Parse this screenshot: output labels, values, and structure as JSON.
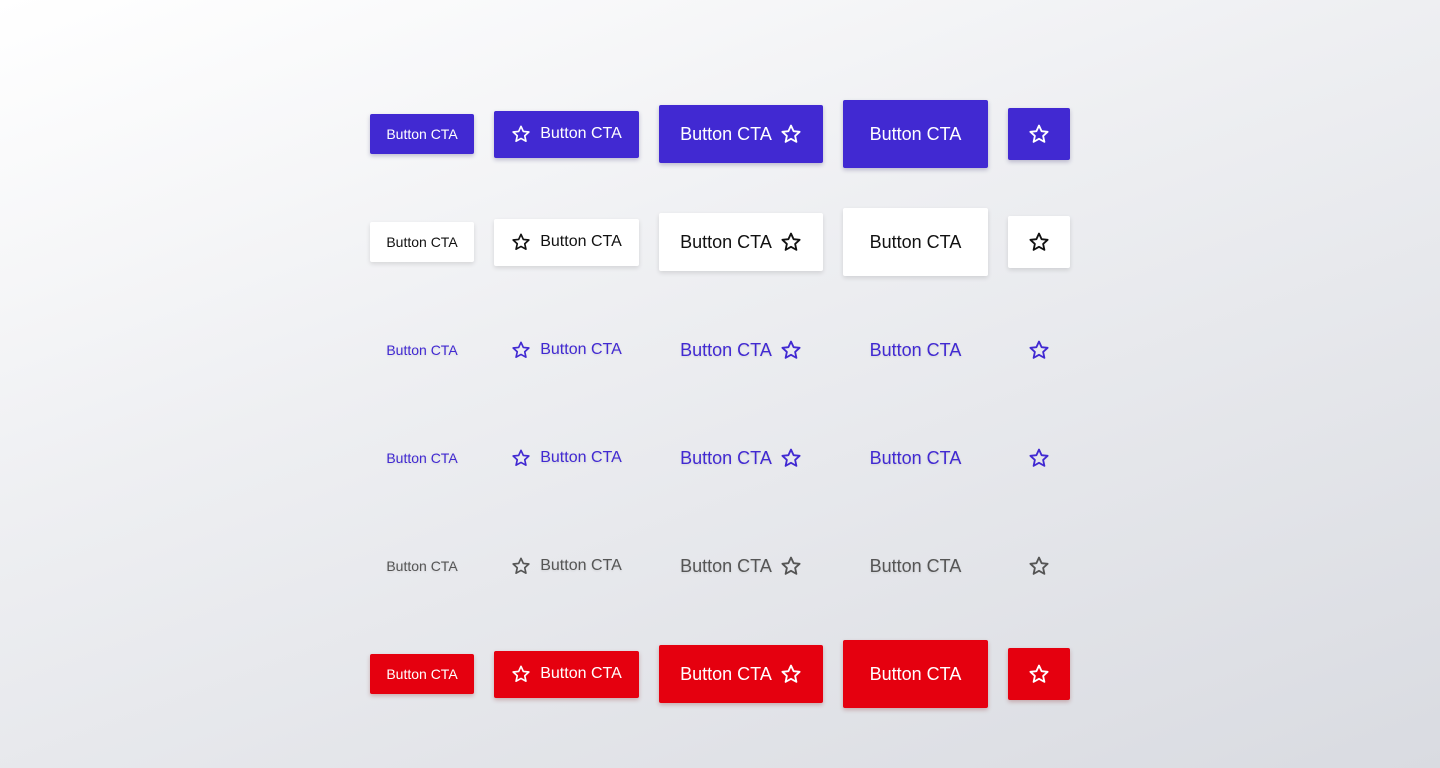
{
  "button_label": "Button CTA",
  "icon": "star-outline-icon",
  "colors": {
    "primary": "#4129d2",
    "danger": "#e5000f",
    "neutral_text": "#555555",
    "secondary_bg": "#ffffff"
  },
  "rows": [
    {
      "variant": "primary",
      "labels": [
        "Button CTA",
        "Button CTA",
        "Button CTA",
        "Button CTA"
      ]
    },
    {
      "variant": "secondary",
      "labels": [
        "Button CTA",
        "Button CTA",
        "Button CTA",
        "Button CTA"
      ]
    },
    {
      "variant": "ghost-primary",
      "labels": [
        "Button CTA",
        "Button CTA",
        "Button CTA",
        "Button CTA"
      ]
    },
    {
      "variant": "ghost-primary-alt",
      "labels": [
        "Button CTA",
        "Button CTA",
        "Button CTA",
        "Button CTA"
      ]
    },
    {
      "variant": "ghost-neutral",
      "labels": [
        "Button CTA",
        "Button CTA",
        "Button CTA",
        "Button CTA"
      ]
    },
    {
      "variant": "danger",
      "labels": [
        "Button CTA",
        "Button CTA",
        "Button CTA",
        "Button CTA"
      ]
    }
  ]
}
